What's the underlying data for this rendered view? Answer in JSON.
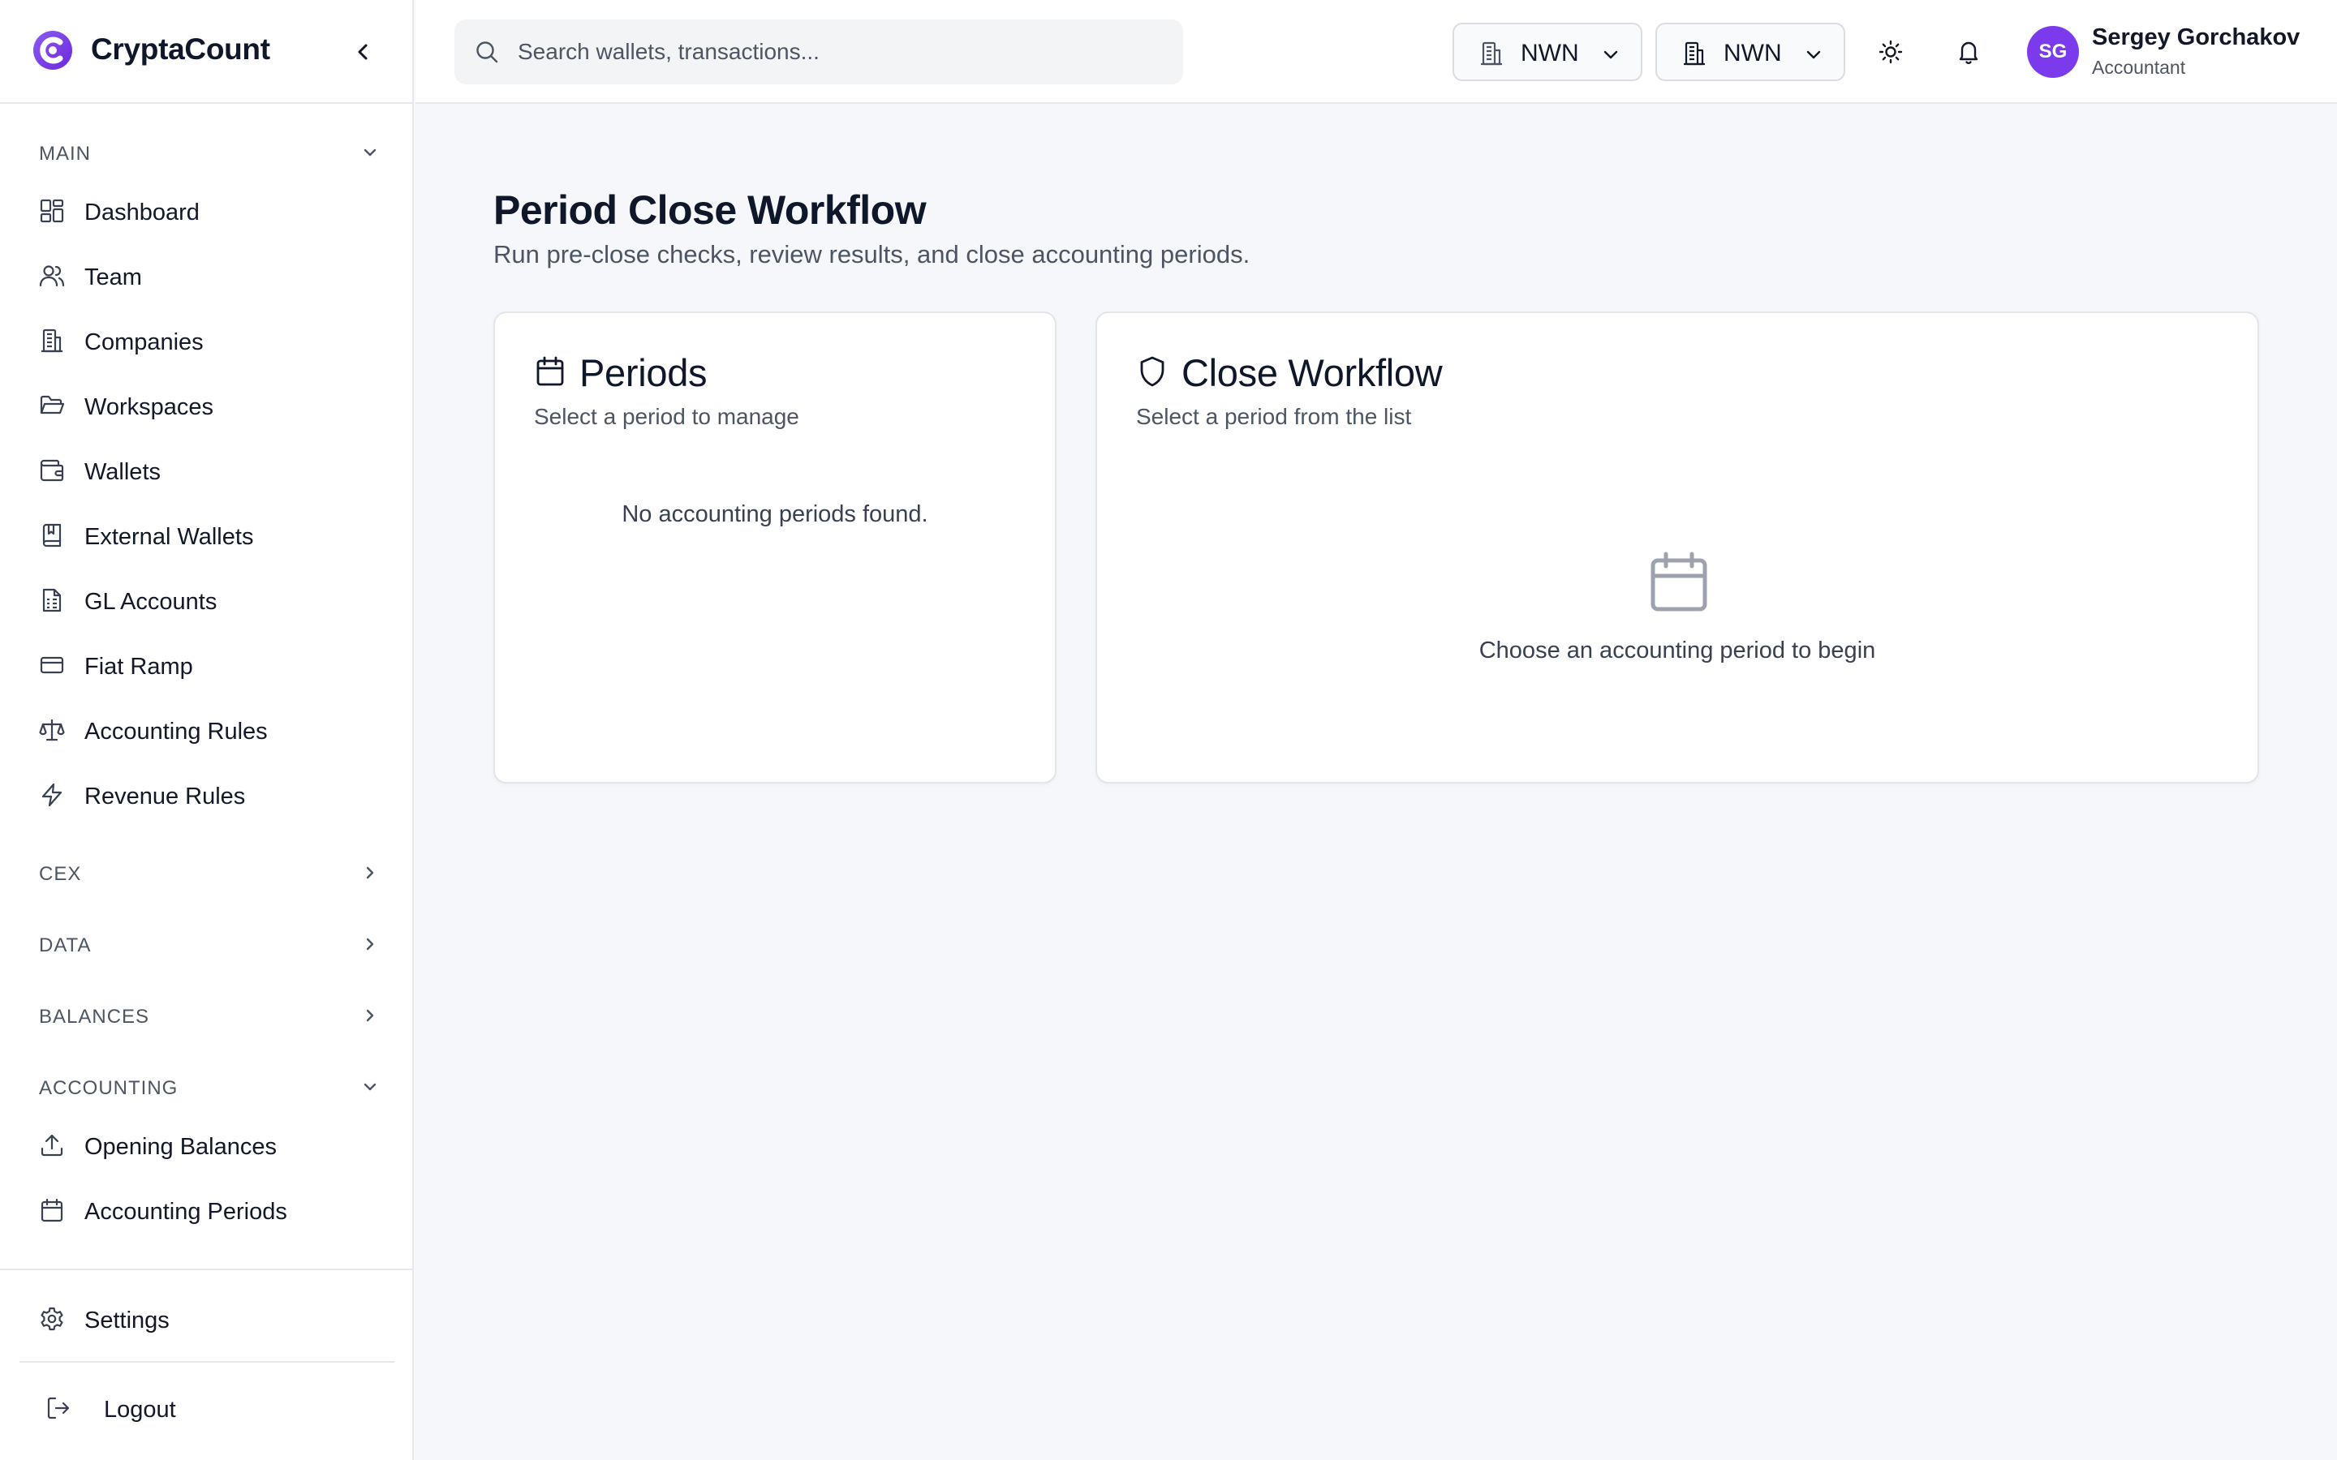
{
  "brand": {
    "name": "CryptaCount",
    "accent": "#7c3aed"
  },
  "sidebar": {
    "sections": {
      "main": "MAIN",
      "cex": "CEX",
      "data": "DATA",
      "balances": "BALANCES",
      "accounting": "ACCOUNTING"
    },
    "main_items": [
      {
        "label": "Dashboard",
        "icon": "dashboard-icon"
      },
      {
        "label": "Team",
        "icon": "users-icon"
      },
      {
        "label": "Companies",
        "icon": "building-icon"
      },
      {
        "label": "Workspaces",
        "icon": "folder-icon"
      },
      {
        "label": "Wallets",
        "icon": "wallet-icon"
      },
      {
        "label": "External Wallets",
        "icon": "book-icon"
      },
      {
        "label": "GL Accounts",
        "icon": "spreadsheet-icon"
      },
      {
        "label": "Fiat Ramp",
        "icon": "credit-card-icon"
      },
      {
        "label": "Accounting Rules",
        "icon": "scale-icon"
      },
      {
        "label": "Revenue Rules",
        "icon": "lightning-icon"
      }
    ],
    "accounting_items": [
      {
        "label": "Opening Balances",
        "icon": "upload-icon"
      },
      {
        "label": "Accounting Periods",
        "icon": "calendar-icon"
      }
    ],
    "settings_label": "Settings",
    "logout_label": "Logout"
  },
  "topbar": {
    "search_placeholder": "Search wallets, transactions...",
    "company_select": "NWN",
    "workspace_select": "NWN",
    "user_initials": "SG",
    "user_name": "Sergey Gorchakov",
    "user_role": "Accountant"
  },
  "page": {
    "title": "Period Close Workflow",
    "subtitle": "Run pre-close checks, review results, and close accounting periods."
  },
  "periods_card": {
    "title": "Periods",
    "subtitle": "Select a period to manage",
    "empty": "No accounting periods found."
  },
  "close_card": {
    "title": "Close Workflow",
    "subtitle": "Select a period from the list",
    "empty": "Choose an accounting period to begin"
  }
}
